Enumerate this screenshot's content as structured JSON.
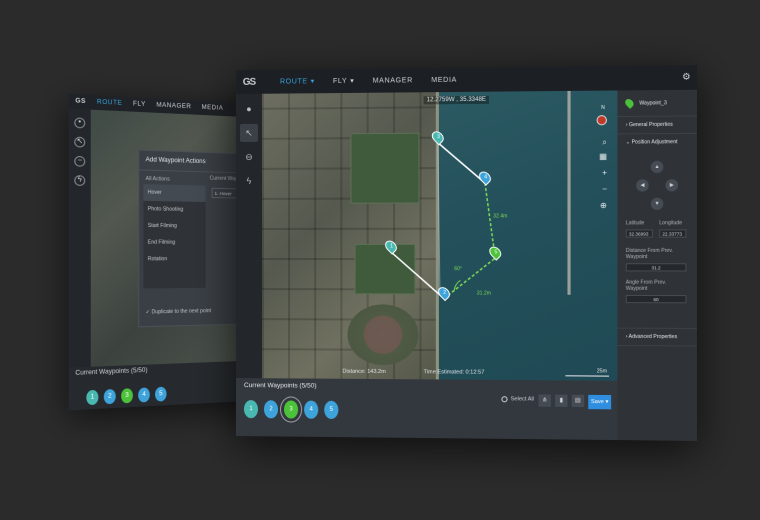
{
  "back_window": {
    "nav": [
      "ROUTE",
      "FLY",
      "MANAGER",
      "MEDIA"
    ],
    "modal": {
      "title": "Add Waypoint Actions",
      "all_actions_label": "All Actions",
      "current_label": "Current Waypoint",
      "current_value": "1. Hover",
      "actions": [
        "Hover",
        "Photo Shooting",
        "Start Filming",
        "End Filming",
        "Rotation"
      ],
      "duplicate_label": "Duplicate to the next point"
    },
    "current_waypoints_label": "Current Waypoints",
    "current_waypoints_count": "(5/50)",
    "pins": [
      "1",
      "2",
      "3",
      "4",
      "5"
    ]
  },
  "main_window": {
    "logo": "GS",
    "tabs": [
      {
        "label": "ROUTE",
        "has_caret": true
      },
      {
        "label": "FLY",
        "has_caret": true
      },
      {
        "label": "MANAGER",
        "has_caret": false
      },
      {
        "label": "MEDIA",
        "has_caret": false
      }
    ],
    "coordinates": "12.2759W , 35.3348E",
    "segment_labels": [
      "32.4m",
      "31.2m"
    ],
    "angle_label": "60°",
    "distance_label": "Distance: 143.2m",
    "time_label": "Time Estimated: 0:12:57",
    "scale_label": "25m",
    "compass_label": "N",
    "current_waypoints_label": "Current Waypoints",
    "current_waypoints_count": "(5/50)",
    "waypoint_pins": [
      "1",
      "2",
      "3",
      "4",
      "5"
    ],
    "select_all_label": "Select All",
    "save_label": "Save",
    "panel": {
      "waypoint_name": "Waypoint_3",
      "general_properties": "General Properties",
      "position_adjustment": "Position Adjustment",
      "latitude_label": "Latitude",
      "longitude_label": "Longitude",
      "latitude_value": "32.36993",
      "longitude_value": "22.33773",
      "distance_label": "Distance From Prev. Waypoint",
      "distance_value": "31.2",
      "angle_label": "Angle From Prev. Waypoint",
      "angle_value": "60",
      "advanced_properties": "Advanced Properties"
    },
    "colors": {
      "accent": "#39a6e0",
      "active_waypoint": "#4cc23a",
      "waypoint": "#3fa3db",
      "teal_waypoint": "#49b8b0",
      "save": "#2f8ee0"
    }
  }
}
